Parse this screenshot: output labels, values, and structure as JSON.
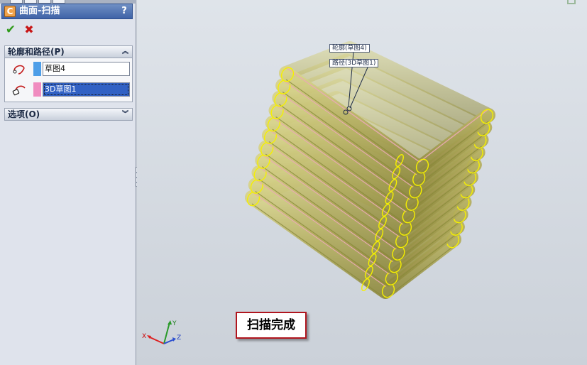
{
  "panel": {
    "title": "曲面-扫描",
    "title_icon": "C",
    "help_label": "?",
    "ok_symbol": "✔",
    "cancel_symbol": "✖",
    "group_profile": {
      "label": "轮廓和路径(P)",
      "profile_value": "草图4",
      "profile_color": "#4d9ee8",
      "path_value": "3D草图1",
      "path_color": "#f08cc0"
    },
    "group_options": {
      "label": "选项(O)"
    }
  },
  "viewport": {
    "callout_profile": "轮廓(草图4)",
    "callout_path": "路径(3D草图1)",
    "status_text": "扫描完成",
    "triad": {
      "x": "X",
      "y": "Y",
      "z": "Z"
    },
    "colors": {
      "surface": "#b3ad5a",
      "surface_edge": "#8a8a3c",
      "loop_ring": "#f6f000",
      "highlight": "#eaaab4"
    }
  }
}
